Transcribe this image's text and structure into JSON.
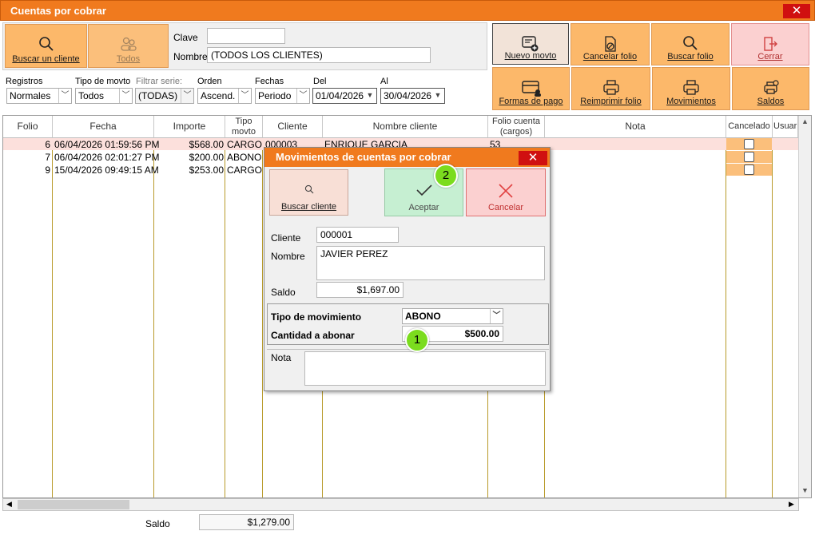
{
  "window": {
    "title": "Cuentas por cobrar",
    "close": "✕"
  },
  "search_panel": {
    "buscar_cliente": "Buscar un cliente",
    "todos": "Todos",
    "clave_label": "Clave",
    "clave_value": "",
    "nombre_label": "Nombre",
    "nombre_value": "(TODOS LOS CLIENTES)"
  },
  "toolbar": {
    "nuevo_movto": "Nuevo movto",
    "cancelar_folio": "Cancelar folio",
    "buscar_folio": "Buscar folio",
    "cerrar": "Cerrar",
    "formas_pago": "Formas de pago",
    "reimprimir_folio": "Reimprimir folio",
    "movimientos": "Movimientos",
    "saldos": "Saldos"
  },
  "filters": {
    "registros_label": "Registros",
    "registros_value": "Normales",
    "tipo_label": "Tipo de movto",
    "tipo_value": "Todos",
    "serie_label": "Filtrar serie:",
    "serie_value": "(TODAS)",
    "orden_label": "Orden",
    "orden_value": "Ascend.",
    "fechas_label": "Fechas",
    "fechas_value": "Periodo",
    "del_label": "Del",
    "del_value": "01/04/2026",
    "al_label": "Al",
    "al_value": "30/04/2026"
  },
  "grid": {
    "columns": [
      "Folio",
      "Fecha",
      "Importe",
      "Tipo movto",
      "Cliente",
      "Nombre cliente",
      "Folio cuenta (cargos)",
      "Nota",
      "Cancelado",
      "Usuar"
    ],
    "rows": [
      {
        "folio": "6",
        "fecha": "06/04/2026 01:59:56 PM",
        "importe": "$568.00",
        "tipo": "CARGO",
        "cliente": "000003",
        "nombre": "ENRIQUE GARCIA",
        "folio_cuenta": "53"
      },
      {
        "folio": "7",
        "fecha": "06/04/2026 02:01:27 PM",
        "importe": "$200.00",
        "tipo": "ABONO",
        "cliente": "",
        "nombre": "",
        "folio_cuenta": ""
      },
      {
        "folio": "9",
        "fecha": "15/04/2026 09:49:15 AM",
        "importe": "$253.00",
        "tipo": "CARGO",
        "cliente": "",
        "nombre": "",
        "folio_cuenta": ""
      }
    ]
  },
  "footer": {
    "saldo_label": "Saldo",
    "saldo_value": "$1,279.00"
  },
  "dialog": {
    "title": "Movimientos de cuentas por cobrar",
    "close": "✕",
    "buscar_cliente": "Buscar cliente",
    "aceptar": "Aceptar",
    "cancelar": "Cancelar",
    "cliente_label": "Cliente",
    "cliente_value": "000001",
    "nombre_label": "Nombre",
    "nombre_value": "JAVIER PEREZ",
    "saldo_label": "Saldo",
    "saldo_value": "$1,697.00",
    "tipo_mov_label": "Tipo de movimiento",
    "tipo_mov_value": "ABONO",
    "cantidad_label": "Cantidad a abonar",
    "cantidad_value": "$500.00",
    "nota_label": "Nota",
    "nota_value": ""
  },
  "badges": {
    "one": "1",
    "two": "2"
  },
  "colors": {
    "accent": "#f07a1e",
    "button": "#fcb86a",
    "close": "#d01010",
    "accept": "#c6efd2",
    "cancel": "#fbd0d0",
    "badge": "#7bdc1e"
  }
}
